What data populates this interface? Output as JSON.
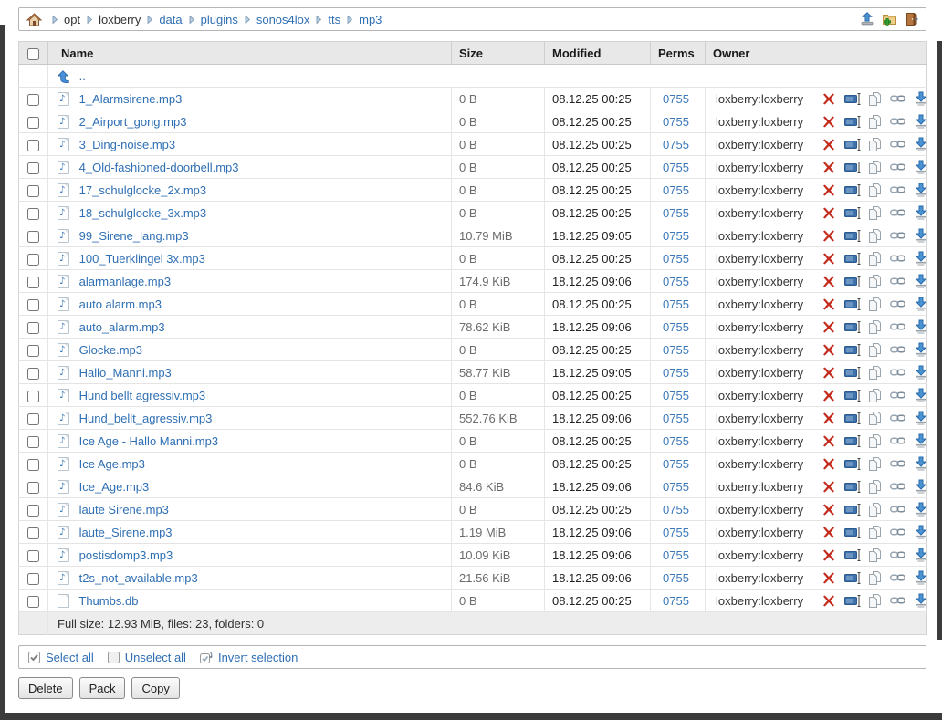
{
  "breadcrumb": {
    "items": [
      {
        "label": "opt",
        "link": false
      },
      {
        "label": "loxberry",
        "link": false
      },
      {
        "label": "data",
        "link": true
      },
      {
        "label": "plugins",
        "link": true
      },
      {
        "label": "sonos4lox",
        "link": true
      },
      {
        "label": "tts",
        "link": true
      },
      {
        "label": "mp3",
        "link": true
      }
    ],
    "home_icon": "home-icon",
    "separator_icon": "chevron-right-icon"
  },
  "toolbar": {
    "icons": [
      "upload-icon",
      "new-folder-icon",
      "exit-icon"
    ]
  },
  "table": {
    "headers": {
      "name": "Name",
      "size": "Size",
      "modified": "Modified",
      "perms": "Perms",
      "owner": "Owner"
    },
    "up_label": "..",
    "row_action_icons": [
      "delete-icon",
      "rename-icon",
      "copy-icon",
      "link-icon",
      "download-icon"
    ],
    "rows": [
      {
        "name": "1_Alarmsirene.mp3",
        "size": "0 B",
        "modified": "08.12.25 00:25",
        "perms": "0755",
        "owner": "loxberry:loxberry",
        "type": "audio"
      },
      {
        "name": "2_Airport_gong.mp3",
        "size": "0 B",
        "modified": "08.12.25 00:25",
        "perms": "0755",
        "owner": "loxberry:loxberry",
        "type": "audio"
      },
      {
        "name": "3_Ding-noise.mp3",
        "size": "0 B",
        "modified": "08.12.25 00:25",
        "perms": "0755",
        "owner": "loxberry:loxberry",
        "type": "audio"
      },
      {
        "name": "4_Old-fashioned-doorbell.mp3",
        "size": "0 B",
        "modified": "08.12.25 00:25",
        "perms": "0755",
        "owner": "loxberry:loxberry",
        "type": "audio"
      },
      {
        "name": "17_schulglocke_2x.mp3",
        "size": "0 B",
        "modified": "08.12.25 00:25",
        "perms": "0755",
        "owner": "loxberry:loxberry",
        "type": "audio"
      },
      {
        "name": "18_schulglocke_3x.mp3",
        "size": "0 B",
        "modified": "08.12.25 00:25",
        "perms": "0755",
        "owner": "loxberry:loxberry",
        "type": "audio"
      },
      {
        "name": "99_Sirene_lang.mp3",
        "size": "10.79 MiB",
        "modified": "18.12.25 09:05",
        "perms": "0755",
        "owner": "loxberry:loxberry",
        "type": "audio"
      },
      {
        "name": "100_Tuerklingel 3x.mp3",
        "size": "0 B",
        "modified": "08.12.25 00:25",
        "perms": "0755",
        "owner": "loxberry:loxberry",
        "type": "audio"
      },
      {
        "name": "alarmanlage.mp3",
        "size": "174.9 KiB",
        "modified": "18.12.25 09:06",
        "perms": "0755",
        "owner": "loxberry:loxberry",
        "type": "audio"
      },
      {
        "name": "auto alarm.mp3",
        "size": "0 B",
        "modified": "08.12.25 00:25",
        "perms": "0755",
        "owner": "loxberry:loxberry",
        "type": "audio"
      },
      {
        "name": "auto_alarm.mp3",
        "size": "78.62 KiB",
        "modified": "18.12.25 09:06",
        "perms": "0755",
        "owner": "loxberry:loxberry",
        "type": "audio"
      },
      {
        "name": "Glocke.mp3",
        "size": "0 B",
        "modified": "08.12.25 00:25",
        "perms": "0755",
        "owner": "loxberry:loxberry",
        "type": "audio"
      },
      {
        "name": "Hallo_Manni.mp3",
        "size": "58.77 KiB",
        "modified": "18.12.25 09:05",
        "perms": "0755",
        "owner": "loxberry:loxberry",
        "type": "audio"
      },
      {
        "name": "Hund bellt agressiv.mp3",
        "size": "0 B",
        "modified": "08.12.25 00:25",
        "perms": "0755",
        "owner": "loxberry:loxberry",
        "type": "audio"
      },
      {
        "name": "Hund_bellt_agressiv.mp3",
        "size": "552.76 KiB",
        "modified": "18.12.25 09:06",
        "perms": "0755",
        "owner": "loxberry:loxberry",
        "type": "audio"
      },
      {
        "name": "Ice Age - Hallo Manni.mp3",
        "size": "0 B",
        "modified": "08.12.25 00:25",
        "perms": "0755",
        "owner": "loxberry:loxberry",
        "type": "audio"
      },
      {
        "name": "Ice Age.mp3",
        "size": "0 B",
        "modified": "08.12.25 00:25",
        "perms": "0755",
        "owner": "loxberry:loxberry",
        "type": "audio"
      },
      {
        "name": "Ice_Age.mp3",
        "size": "84.6 KiB",
        "modified": "18.12.25 09:06",
        "perms": "0755",
        "owner": "loxberry:loxberry",
        "type": "audio"
      },
      {
        "name": "laute Sirene.mp3",
        "size": "0 B",
        "modified": "08.12.25 00:25",
        "perms": "0755",
        "owner": "loxberry:loxberry",
        "type": "audio"
      },
      {
        "name": "laute_Sirene.mp3",
        "size": "1.19 MiB",
        "modified": "18.12.25 09:06",
        "perms": "0755",
        "owner": "loxberry:loxberry",
        "type": "audio"
      },
      {
        "name": "postisdomp3.mp3",
        "size": "10.09 KiB",
        "modified": "18.12.25 09:06",
        "perms": "0755",
        "owner": "loxberry:loxberry",
        "type": "audio"
      },
      {
        "name": "t2s_not_available.mp3",
        "size": "21.56 KiB",
        "modified": "18.12.25 09:06",
        "perms": "0755",
        "owner": "loxberry:loxberry",
        "type": "audio"
      },
      {
        "name": "Thumbs.db",
        "size": "0 B",
        "modified": "08.12.25 00:25",
        "perms": "0755",
        "owner": "loxberry:loxberry",
        "type": "file"
      }
    ],
    "footer": "Full size: 12.93 MiB, files: 23, folders: 0"
  },
  "selection": {
    "select_all": "Select all",
    "unselect_all": "Unselect all",
    "invert": "Invert selection"
  },
  "buttons": {
    "delete": "Delete",
    "pack": "Pack",
    "copy": "Copy"
  },
  "colors": {
    "link": "#2f6fb4",
    "icon_blue": "#4a90d9",
    "delete_red": "#c42b1c",
    "header_bg": "#e8e8e8",
    "footer_bg": "#ededed",
    "frame_edge": "#3b3b3b"
  }
}
